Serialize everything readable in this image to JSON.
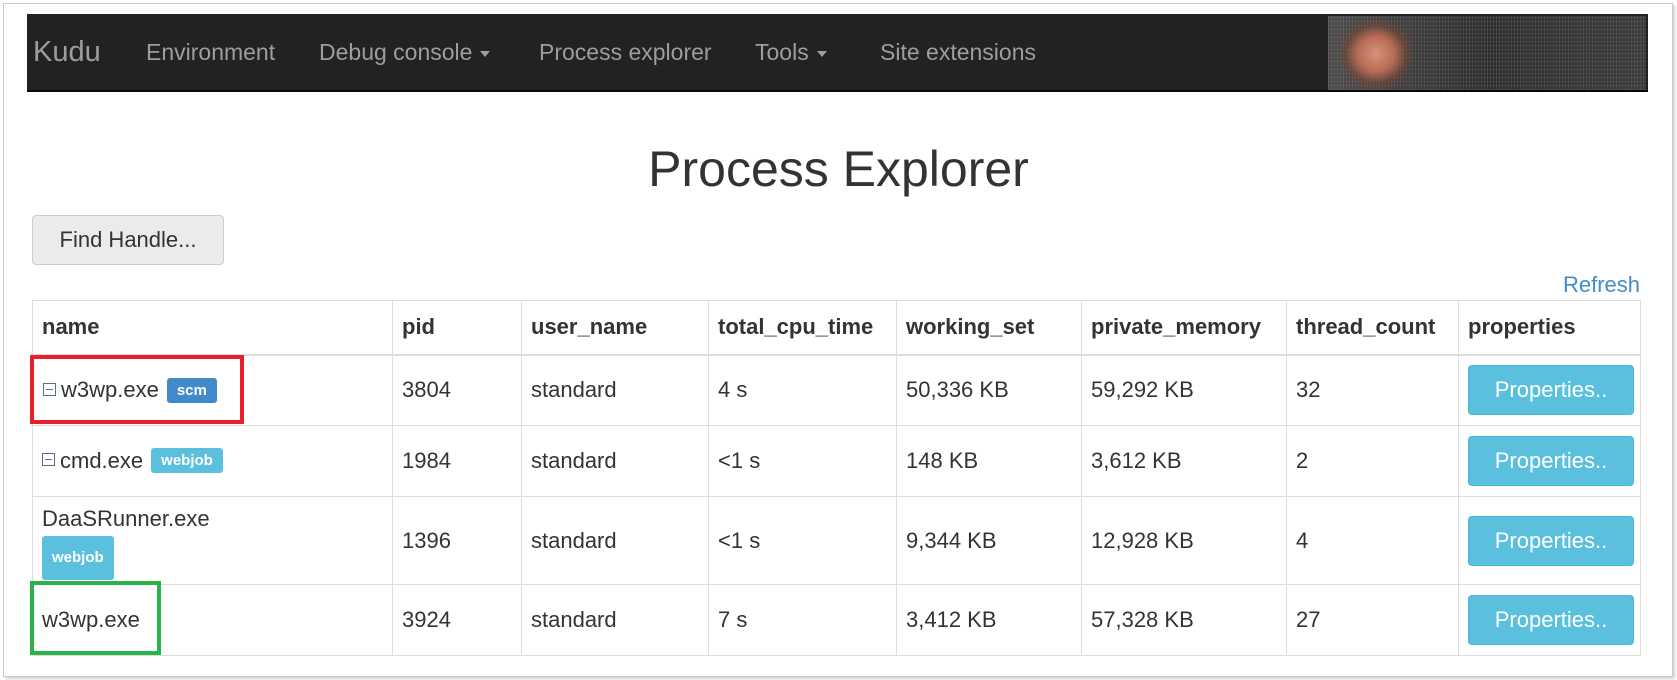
{
  "navbar": {
    "brand": "Kudu",
    "items": [
      {
        "label": "Environment",
        "dropdown": false
      },
      {
        "label": "Debug console",
        "dropdown": true
      },
      {
        "label": "Process explorer",
        "dropdown": false
      },
      {
        "label": "Tools",
        "dropdown": true
      },
      {
        "label": "Site extensions",
        "dropdown": false
      }
    ],
    "background_color": "#222222",
    "text_color": "#9d9d9d"
  },
  "page": {
    "title": "Process Explorer",
    "find_handle_label": "Find Handle...",
    "refresh_label": "Refresh"
  },
  "table": {
    "columns": [
      "name",
      "pid",
      "user_name",
      "total_cpu_time",
      "working_set",
      "private_memory",
      "thread_count",
      "properties"
    ],
    "rows": [
      {
        "name": "w3wp.exe",
        "badge": "scm",
        "pid": "3804",
        "user_name": "standard",
        "total_cpu_time": "4 s",
        "working_set": "50,336 KB",
        "private_memory": "59,292 KB",
        "thread_count": "32",
        "properties_label": "Properties.."
      },
      {
        "name": "cmd.exe",
        "badge": "webjob",
        "pid": "1984",
        "user_name": "standard",
        "total_cpu_time": "<1 s",
        "working_set": "148 KB",
        "private_memory": "3,612 KB",
        "thread_count": "2",
        "properties_label": "Properties.."
      },
      {
        "name": "DaaSRunner.exe",
        "badge": "webjob",
        "pid": "1396",
        "user_name": "standard",
        "total_cpu_time": "<1 s",
        "working_set": "9,344 KB",
        "private_memory": "12,928 KB",
        "thread_count": "4",
        "properties_label": "Properties.."
      },
      {
        "name": "w3wp.exe",
        "badge": "",
        "pid": "3924",
        "user_name": "standard",
        "total_cpu_time": "7 s",
        "working_set": "3,412 KB",
        "private_memory": "57,328 KB",
        "thread_count": "27",
        "properties_label": "Properties.."
      }
    ]
  },
  "colors": {
    "badge_scm": "#428bca",
    "badge_webjob": "#5bc0de",
    "properties_button": "#5bc0de",
    "link": "#428bca",
    "highlight_red": "#e8202a",
    "highlight_green": "#2bb34b"
  },
  "icons": {
    "collapse": "collapse-toggle-icon",
    "dropdown": "caret-down-icon"
  }
}
